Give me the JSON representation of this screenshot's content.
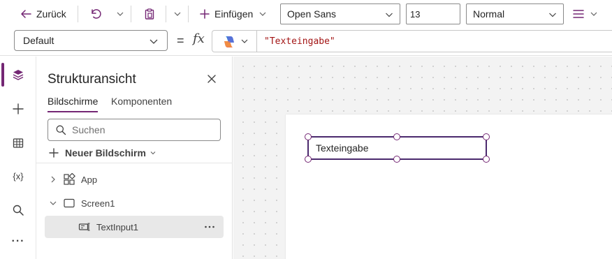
{
  "toolbar": {
    "back_label": "Zurück",
    "insert_label": "Einfügen",
    "font": "Open Sans",
    "font_size": "13",
    "font_weight": "Normal"
  },
  "formula_bar": {
    "property": "Default",
    "equals": "=",
    "fx": "fx",
    "formula": "\"Texteingabe\""
  },
  "tree_panel": {
    "title": "Strukturansicht",
    "tabs": [
      {
        "label": "Bildschirme",
        "active": true
      },
      {
        "label": "Komponenten",
        "active": false
      }
    ],
    "search_placeholder": "Suchen",
    "new_screen_label": "Neuer Bildschirm",
    "items": [
      {
        "label": "App",
        "icon": "app-icon",
        "expand": "collapsed"
      },
      {
        "label": "Screen1",
        "icon": "screen-icon",
        "expand": "expanded"
      },
      {
        "label": "TextInput1",
        "icon": "text-input-icon",
        "selected": true
      }
    ]
  },
  "left_rail": {
    "items": [
      "tree-view-icon",
      "insert-icon",
      "data-icon",
      "variables-icon",
      "search-icon",
      "more-icon"
    ],
    "variables_glyph": "{x}",
    "more_glyph": "···"
  },
  "canvas": {
    "textinput_value": "Texteingabe"
  },
  "colors": {
    "accent": "#742774",
    "selection_border": "#4b2a6e",
    "formula_string": "#a31515",
    "selected_row": "#e8e8e8"
  }
}
